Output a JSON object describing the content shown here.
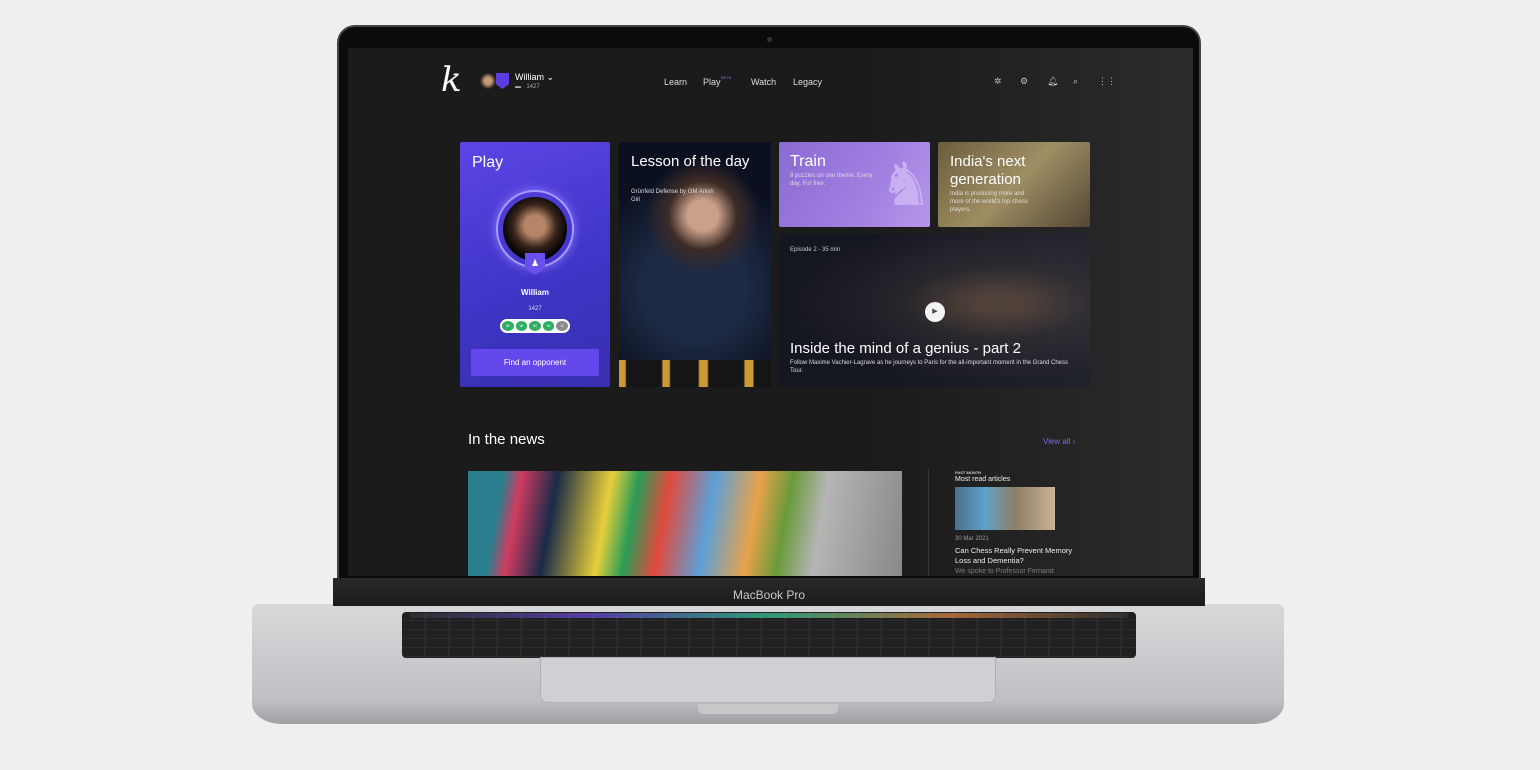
{
  "device": {
    "label": "MacBook Pro"
  },
  "header": {
    "logo": "k",
    "user": {
      "name": "William",
      "rating": "1427"
    },
    "nav": [
      {
        "label": "Learn"
      },
      {
        "label": "Play",
        "badge": "BETA"
      },
      {
        "label": "Watch"
      },
      {
        "label": "Legacy"
      }
    ],
    "icons": [
      "bug-icon",
      "settings-icon",
      "bell-icon",
      "search-icon",
      "apps-grid-icon"
    ]
  },
  "play_card": {
    "title": "Play",
    "name": "William",
    "rating": "1427",
    "results": [
      "W",
      "W",
      "W",
      "W",
      "D"
    ],
    "button": "Find an opponent",
    "accent": "#5b45e6"
  },
  "lesson_card": {
    "title": "Lesson of the day",
    "subtitle": "Grünfeld Defense by GM Anish Giri"
  },
  "train_card": {
    "title": "Train",
    "subtitle": "8 puzzles on one theme. Every day. For free."
  },
  "india_card": {
    "title": "India's next generation",
    "subtitle": "India is producing more and more of the world's top chess players."
  },
  "episode_card": {
    "meta": "Episode 2 - 35 min",
    "title": "Inside the mind of a genius - part 2",
    "subtitle": "Follow Maxime Vachier-Lagrave as he journeys to Paris for the all-important moment in the Grand Chess Tour."
  },
  "news": {
    "title": "In the news",
    "view_all": "View all",
    "sidebar": {
      "eyebrow": "PAST MONTH",
      "title": "Most read articles",
      "article": {
        "date": "30 Mar 2021",
        "title": "Can Chess Really Prevent Memory Loss and Dementia?",
        "excerpt": "We spoke to Professor Fernand"
      }
    }
  }
}
